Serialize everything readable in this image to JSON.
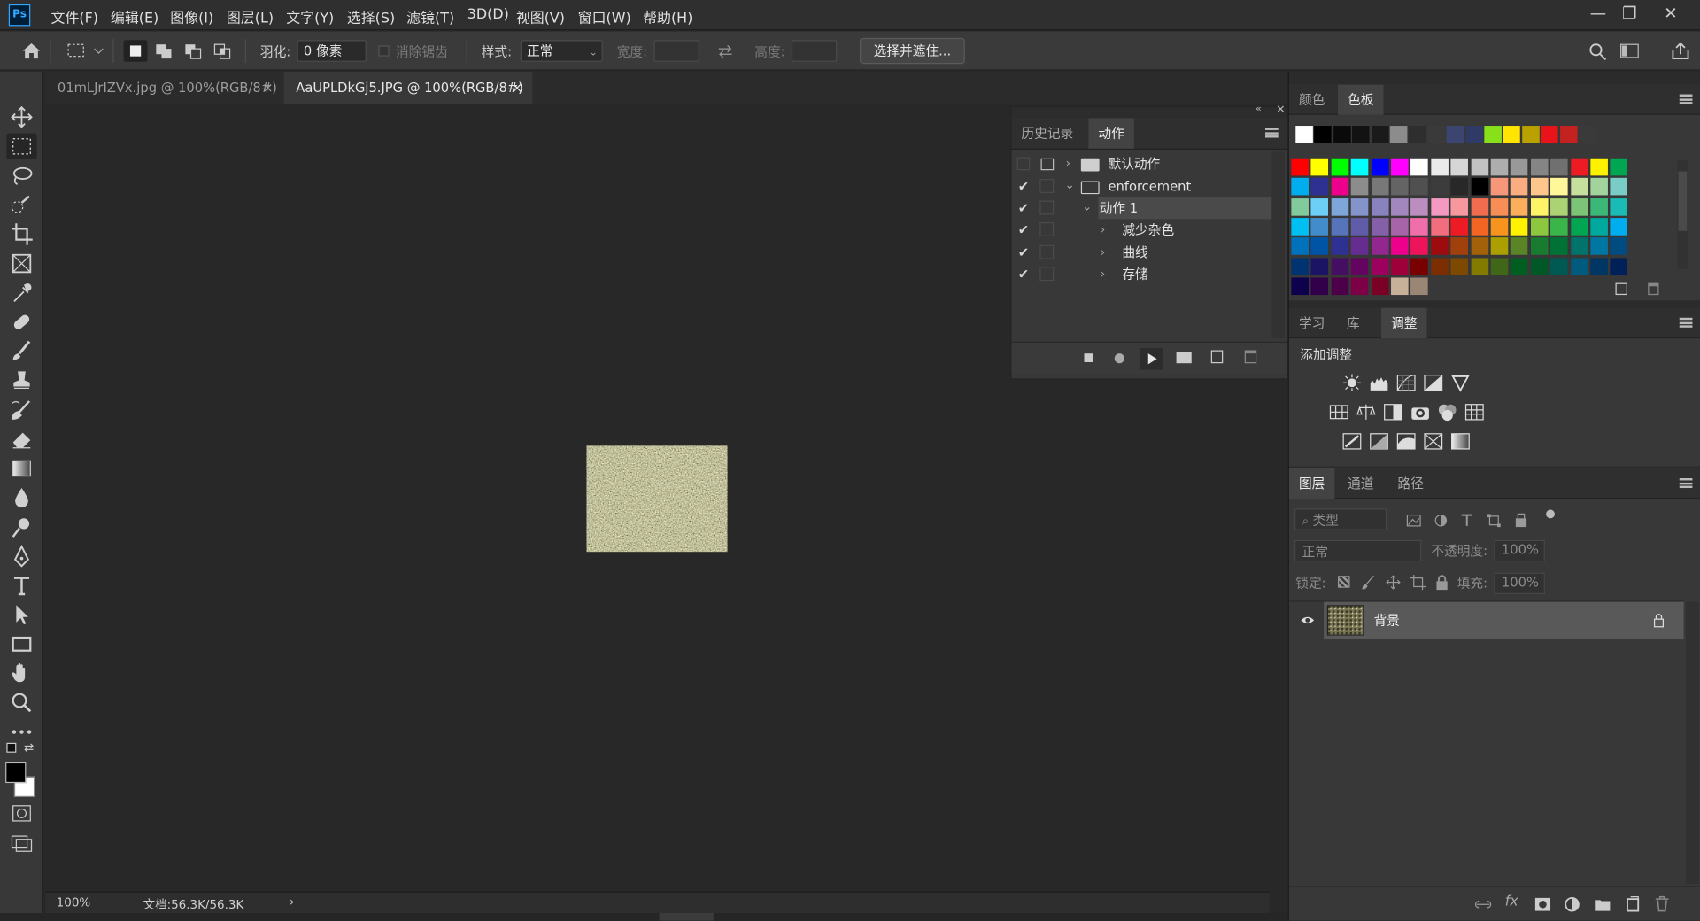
{
  "app": {
    "logo": "Ps"
  },
  "menu": [
    "文件(F)",
    "编辑(E)",
    "图像(I)",
    "图层(L)",
    "文字(Y)",
    "选择(S)",
    "滤镜(T)",
    "3D(D)",
    "视图(V)",
    "窗口(W)",
    "帮助(H)"
  ],
  "window_controls": {
    "minimize": "—",
    "restore": "❐",
    "close": "✕"
  },
  "options": {
    "feather_label": "羽化:",
    "feather_value": "0 像素",
    "antialias_label": "消除锯齿",
    "style_label": "样式:",
    "style_value": "正常",
    "width_label": "宽度:",
    "height_label": "高度:",
    "refine_button": "选择并遮住..."
  },
  "tabs": [
    {
      "label": "01mLJrIZVx.jpg @ 100%(RGB/8#)",
      "close": "×"
    },
    {
      "label": "AaUPLDkGj5.JPG @ 100%(RGB/8#)",
      "close": "×"
    }
  ],
  "status": {
    "zoom": "100%",
    "doc": "文档:56.3K/56.3K",
    "arrow": "›"
  },
  "actions_panel": {
    "tabs": [
      "历史记录",
      "动作"
    ],
    "rows": [
      {
        "label": "默认动作",
        "checked": false
      },
      {
        "label": "enforcement",
        "checked": true
      },
      {
        "label": "动作 1",
        "checked": true
      },
      {
        "label": "减少杂色",
        "checked": true
      },
      {
        "label": "曲线",
        "checked": true
      },
      {
        "label": "存储",
        "checked": true
      }
    ],
    "check_mark": "✔"
  },
  "swatches_panel": {
    "tabs": [
      "颜色",
      "色板"
    ],
    "recent": [
      "#ffffff",
      "#000000",
      "#0a0a0a",
      "#121212",
      "#1a1a1a",
      "#8c8c8c",
      "#2e2e2e",
      "#3a3a3a",
      "#3b4570",
      "#2f3a66",
      "#88e01a",
      "#ffe500",
      "#b9a100",
      "#e8141a",
      "#c42121",
      "#3a3a3a"
    ],
    "grid": [
      [
        "#ff0000",
        "#ffff00",
        "#00ff00",
        "#00ffff",
        "#0000ff",
        "#ff00ff",
        "#ffffff",
        "#ebebeb",
        "#d6d6d6",
        "#c2c2c2",
        "#adadad",
        "#999999",
        "#858585",
        "#707070",
        "#ed1c24",
        "#fff200",
        "#00a651"
      ],
      [
        "#00aeef",
        "#2e3192",
        "#ec008c",
        "#8c8c8c",
        "#787878",
        "#646464",
        "#505050",
        "#3c3c3c",
        "#282828",
        "#000000",
        "#f7977a",
        "#fbad82",
        "#fdc68c",
        "#fff799",
        "#c6df9c",
        "#a3d39c",
        "#7accc8"
      ],
      [
        "#82ca9c",
        "#6dcff6",
        "#7da7d9",
        "#8493ca",
        "#8882be",
        "#a187be",
        "#bc8dbf",
        "#f49ac2",
        "#f6989d",
        "#f26c4f",
        "#f68e56",
        "#fbaf5d",
        "#fff467",
        "#acd373",
        "#7cc576",
        "#3bb878",
        "#1abbb4"
      ],
      [
        "#00bff3",
        "#438ccb",
        "#5574b9",
        "#605ca8",
        "#8560a8",
        "#a864a8",
        "#f06ea9",
        "#f26d7d",
        "#ed1c24",
        "#f26522",
        "#f7941d",
        "#fff200",
        "#8dc63f",
        "#39b54a",
        "#00a651",
        "#00a99d",
        "#00aeef"
      ],
      [
        "#0072bc",
        "#0054a6",
        "#2e3192",
        "#662d91",
        "#92278f",
        "#ec008c",
        "#ed145b",
        "#9e0b0f",
        "#a0410d",
        "#a36209",
        "#aba000",
        "#598527",
        "#197b30",
        "#007236",
        "#00746b",
        "#0076a3",
        "#004b80"
      ],
      [
        "#003471",
        "#1b1464",
        "#440e62",
        "#630460",
        "#9e005d",
        "#9e0039",
        "#790000",
        "#7b2e00",
        "#7d4900",
        "#827b00",
        "#406618",
        "#005e20",
        "#005826",
        "#005952",
        "#005b7f",
        "#003663",
        "#002157"
      ],
      [
        "#0d004c",
        "#32004b",
        "#4b0049",
        "#7b0046",
        "#7a0026",
        "#c7b299",
        "#998675"
      ]
    ]
  },
  "learn_panel": {
    "tabs": [
      "学习",
      "库",
      "调整"
    ],
    "add_adjustment": "添加调整"
  },
  "layers_panel": {
    "tabs": [
      "图层",
      "通道",
      "路径"
    ],
    "filter_placeholder": "类型",
    "blend_mode": "正常",
    "opacity_label": "不透明度:",
    "opacity_value": "100%",
    "lock_label": "锁定:",
    "fill_label": "填充:",
    "fill_value": "100%",
    "layer_name": "背景"
  }
}
